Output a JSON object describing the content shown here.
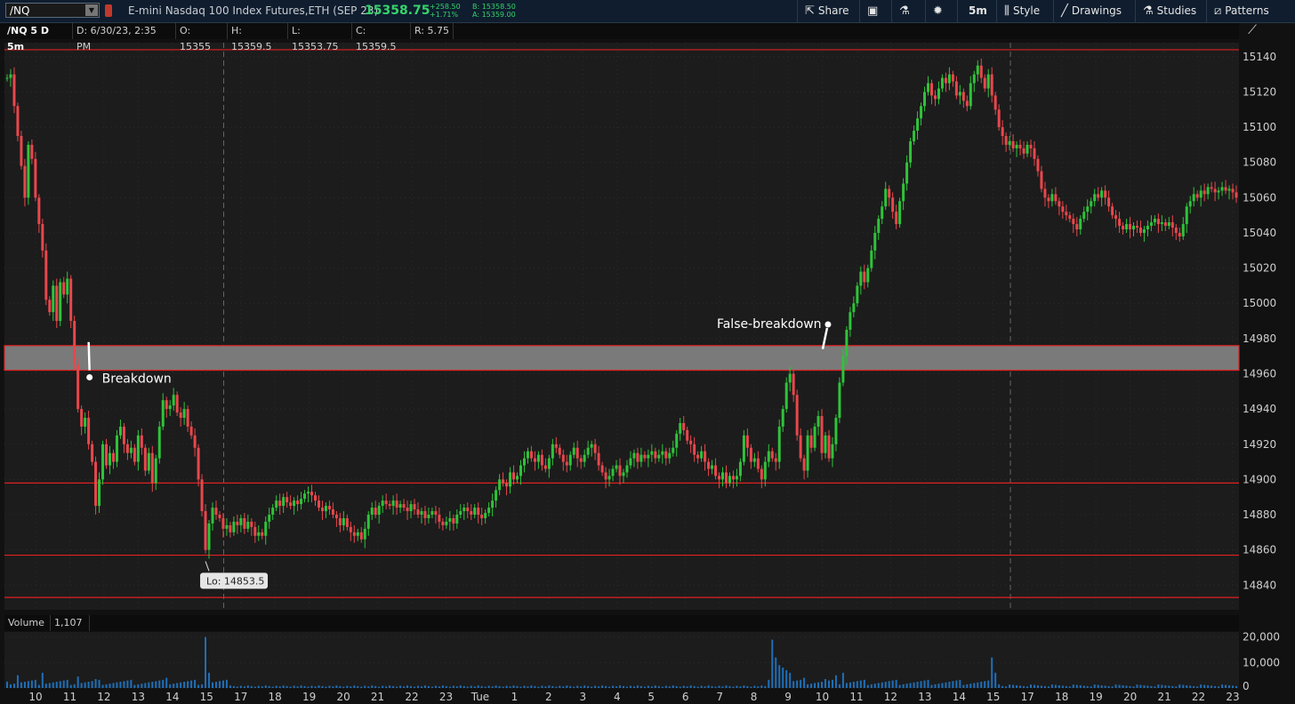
{
  "toolbar": {
    "symbol": "/NQ",
    "description": "E-mini Nasdaq 100 Index Futures,ETH (SEP 23)",
    "last_price": "15358.75",
    "net_change": "+258.50",
    "pct_change": "+1.71%",
    "bid": "B: 15358.50",
    "ask": "A: 15359.00",
    "buttons": {
      "share": "Share",
      "aggregation": "5m",
      "style": "Style",
      "drawings": "Drawings",
      "studies": "Studies",
      "patterns": "Patterns"
    },
    "colors": {
      "up": "#36d36a",
      "background": "#0f1d2e"
    }
  },
  "infobar": {
    "symbol": "/NQ 5 D 5m",
    "date": "D: 6/30/23, 2:35 PM",
    "open": "O: 15355",
    "high": "H: 15359.5",
    "low": "L: 15353.75",
    "close": "C: 15359.5",
    "range": "R: 5.75"
  },
  "volume_panel": {
    "label": "Volume",
    "value": "1,107"
  },
  "chart_data": {
    "type": "candlestick",
    "price_axis": {
      "ylim": [
        14826,
        15148
      ],
      "ticks": [
        15140,
        15120,
        15100,
        15080,
        15060,
        15040,
        15020,
        15000,
        14980,
        14960,
        14940,
        14920,
        14900,
        14880,
        14860,
        14840
      ]
    },
    "volume_axis": {
      "ylim": [
        0,
        22000
      ],
      "ticks": [
        "20,000",
        "10,000",
        "0"
      ]
    },
    "time_ticks": [
      "10",
      "11",
      "12",
      "13",
      "14",
      "15",
      "17",
      "18",
      "19",
      "20",
      "21",
      "22",
      "23",
      "Tue",
      "1",
      "2",
      "3",
      "4",
      "5",
      "6",
      "7",
      "8",
      "9",
      "10",
      "11",
      "12",
      "13",
      "14",
      "15",
      "17",
      "18",
      "19",
      "20",
      "21",
      "22",
      "23"
    ],
    "session_dividers_after_tick": [
      "15"
    ],
    "horizontal_levels": [
      15144,
      14898,
      14857,
      14833
    ],
    "zone": {
      "from": 14962,
      "to": 14976,
      "color": "#7a7a7a"
    },
    "annotations": [
      {
        "text": "Breakdown",
        "arrow": "down"
      },
      {
        "text": "False-breakdown",
        "arrow": "up"
      },
      {
        "text": "Lo: 14853.5"
      }
    ],
    "price_path": [
      [
        0,
        15128
      ],
      [
        4,
        15130
      ],
      [
        8,
        15112
      ],
      [
        12,
        15095
      ],
      [
        16,
        15078
      ],
      [
        20,
        15060
      ],
      [
        24,
        15090
      ],
      [
        28,
        15082
      ],
      [
        32,
        15060
      ],
      [
        36,
        15045
      ],
      [
        40,
        15030
      ],
      [
        44,
        15002
      ],
      [
        48,
        14995
      ],
      [
        52,
        15010
      ],
      [
        56,
        14990
      ],
      [
        60,
        15012
      ],
      [
        64,
        15005
      ],
      [
        68,
        15014
      ],
      [
        72,
        14990
      ],
      [
        76,
        14965
      ],
      [
        80,
        14940
      ],
      [
        84,
        14930
      ],
      [
        88,
        14935
      ],
      [
        92,
        14920
      ],
      [
        96,
        14910
      ],
      [
        100,
        14885
      ],
      [
        104,
        14900
      ],
      [
        108,
        14920
      ],
      [
        112,
        14908
      ],
      [
        116,
        14915
      ],
      [
        120,
        14910
      ],
      [
        124,
        14925
      ],
      [
        128,
        14930
      ],
      [
        132,
        14920
      ],
      [
        136,
        14915
      ],
      [
        140,
        14918
      ],
      [
        144,
        14910
      ],
      [
        148,
        14925
      ],
      [
        152,
        14918
      ],
      [
        156,
        14905
      ],
      [
        160,
        14915
      ],
      [
        164,
        14898
      ],
      [
        168,
        14912
      ],
      [
        172,
        14930
      ],
      [
        176,
        14945
      ],
      [
        180,
        14940
      ],
      [
        184,
        14942
      ],
      [
        188,
        14948
      ],
      [
        192,
        14938
      ],
      [
        196,
        14935
      ],
      [
        200,
        14940
      ],
      [
        204,
        14930
      ],
      [
        208,
        14925
      ],
      [
        212,
        14918
      ],
      [
        216,
        14900
      ],
      [
        220,
        14882
      ],
      [
        224,
        14860
      ],
      [
        228,
        14875
      ],
      [
        232,
        14884
      ],
      [
        236,
        14880
      ],
      [
        240,
        14878
      ],
      [
        244,
        14872
      ],
      [
        248,
        14874
      ],
      [
        252,
        14870
      ],
      [
        256,
        14876
      ],
      [
        260,
        14874
      ],
      [
        264,
        14878
      ],
      [
        268,
        14872
      ],
      [
        272,
        14876
      ],
      [
        276,
        14873
      ],
      [
        280,
        14868
      ],
      [
        284,
        14870
      ],
      [
        288,
        14868
      ],
      [
        292,
        14876
      ],
      [
        296,
        14880
      ],
      [
        300,
        14884
      ],
      [
        304,
        14888
      ],
      [
        308,
        14885
      ],
      [
        312,
        14890
      ],
      [
        316,
        14887
      ],
      [
        320,
        14885
      ],
      [
        324,
        14888
      ],
      [
        328,
        14886
      ],
      [
        332,
        14889
      ],
      [
        336,
        14892
      ],
      [
        340,
        14893
      ],
      [
        344,
        14891
      ],
      [
        348,
        14888
      ],
      [
        352,
        14884
      ],
      [
        356,
        14882
      ],
      [
        360,
        14885
      ],
      [
        364,
        14883
      ],
      [
        368,
        14880
      ],
      [
        372,
        14878
      ],
      [
        376,
        14874
      ],
      [
        380,
        14878
      ],
      [
        384,
        14873
      ],
      [
        388,
        14870
      ],
      [
        392,
        14868
      ],
      [
        396,
        14870
      ],
      [
        400,
        14866
      ],
      [
        404,
        14872
      ],
      [
        408,
        14880
      ],
      [
        412,
        14884
      ],
      [
        416,
        14880
      ],
      [
        420,
        14885
      ],
      [
        424,
        14888
      ],
      [
        428,
        14886
      ],
      [
        432,
        14885
      ],
      [
        436,
        14888
      ],
      [
        440,
        14884
      ],
      [
        444,
        14886
      ],
      [
        448,
        14884
      ],
      [
        452,
        14882
      ],
      [
        456,
        14886
      ],
      [
        460,
        14883
      ],
      [
        464,
        14880
      ],
      [
        468,
        14882
      ],
      [
        472,
        14878
      ],
      [
        476,
        14880
      ],
      [
        480,
        14882
      ],
      [
        484,
        14880
      ],
      [
        488,
        14876
      ],
      [
        492,
        14874
      ],
      [
        496,
        14876
      ],
      [
        500,
        14878
      ],
      [
        504,
        14875
      ],
      [
        508,
        14880
      ],
      [
        512,
        14882
      ],
      [
        516,
        14884
      ],
      [
        520,
        14882
      ],
      [
        524,
        14880
      ],
      [
        528,
        14884
      ],
      [
        532,
        14880
      ],
      [
        536,
        14878
      ],
      [
        540,
        14881
      ],
      [
        544,
        14884
      ],
      [
        548,
        14888
      ],
      [
        552,
        14894
      ],
      [
        556,
        14900
      ],
      [
        560,
        14898
      ],
      [
        564,
        14896
      ],
      [
        568,
        14904
      ],
      [
        572,
        14900
      ],
      [
        576,
        14902
      ],
      [
        580,
        14908
      ],
      [
        584,
        14912
      ],
      [
        588,
        14916
      ],
      [
        592,
        14912
      ],
      [
        596,
        14910
      ],
      [
        600,
        14914
      ],
      [
        604,
        14908
      ],
      [
        608,
        14906
      ],
      [
        612,
        14912
      ],
      [
        616,
        14920
      ],
      [
        620,
        14918
      ],
      [
        624,
        14914
      ],
      [
        628,
        14910
      ],
      [
        632,
        14908
      ],
      [
        636,
        14914
      ],
      [
        640,
        14918
      ],
      [
        644,
        14912
      ],
      [
        648,
        14910
      ],
      [
        652,
        14914
      ],
      [
        656,
        14918
      ],
      [
        660,
        14920
      ],
      [
        664,
        14915
      ],
      [
        668,
        14908
      ],
      [
        672,
        14904
      ],
      [
        676,
        14900
      ],
      [
        680,
        14902
      ],
      [
        684,
        14906
      ],
      [
        688,
        14908
      ],
      [
        692,
        14902
      ],
      [
        696,
        14904
      ],
      [
        700,
        14908
      ],
      [
        704,
        14912
      ],
      [
        708,
        14915
      ],
      [
        712,
        14910
      ],
      [
        716,
        14914
      ],
      [
        720,
        14912
      ],
      [
        724,
        14914
      ],
      [
        728,
        14916
      ],
      [
        732,
        14912
      ],
      [
        736,
        14914
      ],
      [
        740,
        14916
      ],
      [
        744,
        14912
      ],
      [
        748,
        14915
      ],
      [
        752,
        14918
      ],
      [
        756,
        14926
      ],
      [
        760,
        14932
      ],
      [
        764,
        14928
      ],
      [
        768,
        14922
      ],
      [
        772,
        14920
      ],
      [
        776,
        14914
      ],
      [
        780,
        14912
      ],
      [
        784,
        14916
      ],
      [
        788,
        14910
      ],
      [
        792,
        14906
      ],
      [
        796,
        14908
      ],
      [
        800,
        14902
      ],
      [
        804,
        14900
      ],
      [
        808,
        14904
      ],
      [
        812,
        14898
      ],
      [
        816,
        14902
      ],
      [
        820,
        14900
      ],
      [
        824,
        14902
      ],
      [
        828,
        14910
      ],
      [
        832,
        14925
      ],
      [
        836,
        14918
      ],
      [
        840,
        14910
      ],
      [
        844,
        14912
      ],
      [
        848,
        14906
      ],
      [
        852,
        14900
      ],
      [
        856,
        14910
      ],
      [
        860,
        14916
      ],
      [
        864,
        14912
      ],
      [
        868,
        14910
      ],
      [
        872,
        14930
      ],
      [
        876,
        14940
      ],
      [
        880,
        14955
      ],
      [
        884,
        14960
      ],
      [
        888,
        14948
      ],
      [
        892,
        14925
      ],
      [
        896,
        14912
      ],
      [
        900,
        14905
      ],
      [
        904,
        14925
      ],
      [
        908,
        14918
      ],
      [
        912,
        14930
      ],
      [
        916,
        14936
      ],
      [
        920,
        14915
      ],
      [
        924,
        14925
      ],
      [
        928,
        14912
      ],
      [
        932,
        14920
      ],
      [
        936,
        14935
      ],
      [
        940,
        14955
      ],
      [
        944,
        14970
      ],
      [
        948,
        14985
      ],
      [
        952,
        14995
      ],
      [
        956,
        15000
      ],
      [
        960,
        15010
      ],
      [
        964,
        15018
      ],
      [
        968,
        15012
      ],
      [
        972,
        15020
      ],
      [
        976,
        15030
      ],
      [
        980,
        15040
      ],
      [
        984,
        15048
      ],
      [
        988,
        15055
      ],
      [
        992,
        15065
      ],
      [
        996,
        15060
      ],
      [
        1000,
        15052
      ],
      [
        1004,
        15045
      ],
      [
        1008,
        15058
      ],
      [
        1012,
        15068
      ],
      [
        1016,
        15080
      ],
      [
        1020,
        15092
      ],
      [
        1024,
        15098
      ],
      [
        1028,
        15105
      ],
      [
        1032,
        15112
      ],
      [
        1036,
        15120
      ],
      [
        1040,
        15125
      ],
      [
        1044,
        15118
      ],
      [
        1048,
        15116
      ],
      [
        1052,
        15122
      ],
      [
        1056,
        15128
      ],
      [
        1060,
        15125
      ],
      [
        1064,
        15130
      ],
      [
        1068,
        15126
      ],
      [
        1072,
        15118
      ],
      [
        1076,
        15120
      ],
      [
        1080,
        15115
      ],
      [
        1084,
        15112
      ],
      [
        1088,
        15125
      ],
      [
        1092,
        15130
      ],
      [
        1096,
        15135
      ],
      [
        1100,
        15128
      ],
      [
        1104,
        15122
      ],
      [
        1108,
        15130
      ],
      [
        1112,
        15118
      ],
      [
        1116,
        15110
      ],
      [
        1120,
        15100
      ],
      [
        1124,
        15095
      ],
      [
        1128,
        15090
      ],
      [
        1132,
        15092
      ],
      [
        1136,
        15088
      ],
      [
        1140,
        15090
      ],
      [
        1144,
        15088
      ],
      [
        1148,
        15085
      ],
      [
        1152,
        15090
      ],
      [
        1156,
        15088
      ],
      [
        1160,
        15082
      ],
      [
        1164,
        15075
      ],
      [
        1168,
        15065
      ],
      [
        1172,
        15060
      ],
      [
        1176,
        15058
      ],
      [
        1180,
        15062
      ],
      [
        1184,
        15058
      ],
      [
        1188,
        15055
      ],
      [
        1192,
        15052
      ],
      [
        1196,
        15050
      ],
      [
        1200,
        15048
      ],
      [
        1204,
        15045
      ],
      [
        1208,
        15042
      ],
      [
        1212,
        15048
      ],
      [
        1216,
        15052
      ],
      [
        1220,
        15055
      ],
      [
        1224,
        15058
      ],
      [
        1228,
        15062
      ],
      [
        1232,
        15060
      ],
      [
        1236,
        15064
      ],
      [
        1240,
        15060
      ],
      [
        1244,
        15055
      ],
      [
        1248,
        15050
      ],
      [
        1252,
        15048
      ],
      [
        1256,
        15044
      ],
      [
        1260,
        15042
      ],
      [
        1264,
        15045
      ],
      [
        1268,
        15042
      ],
      [
        1272,
        15044
      ],
      [
        1276,
        15043
      ],
      [
        1280,
        15040
      ],
      [
        1284,
        15042
      ],
      [
        1288,
        15044
      ],
      [
        1292,
        15046
      ],
      [
        1296,
        15048
      ],
      [
        1300,
        15045
      ],
      [
        1304,
        15046
      ],
      [
        1308,
        15044
      ],
      [
        1312,
        15046
      ],
      [
        1316,
        15043
      ],
      [
        1320,
        15040
      ],
      [
        1324,
        15038
      ],
      [
        1328,
        15045
      ],
      [
        1332,
        15055
      ],
      [
        1336,
        15058
      ],
      [
        1340,
        15062
      ],
      [
        1344,
        15060
      ],
      [
        1348,
        15064
      ],
      [
        1352,
        15062
      ],
      [
        1356,
        15066
      ],
      [
        1360,
        15065
      ],
      [
        1364,
        15063
      ],
      [
        1368,
        15064
      ],
      [
        1372,
        15066
      ],
      [
        1376,
        15064
      ],
      [
        1380,
        15065
      ],
      [
        1384,
        15063
      ],
      [
        1388,
        15060
      ]
    ],
    "volume_spikes": [
      [
        0,
        2500
      ],
      [
        12,
        5000
      ],
      [
        40,
        6000
      ],
      [
        80,
        4500
      ],
      [
        100,
        3500
      ],
      [
        180,
        4000
      ],
      [
        224,
        20000
      ],
      [
        228,
        6000
      ],
      [
        864,
        19000
      ],
      [
        868,
        12000
      ],
      [
        872,
        9000
      ],
      [
        876,
        8000
      ],
      [
        880,
        7000
      ],
      [
        884,
        6000
      ],
      [
        900,
        4000
      ],
      [
        924,
        3500
      ],
      [
        936,
        5000
      ],
      [
        944,
        6000
      ],
      [
        1112,
        12000
      ],
      [
        1116,
        6000
      ]
    ]
  }
}
